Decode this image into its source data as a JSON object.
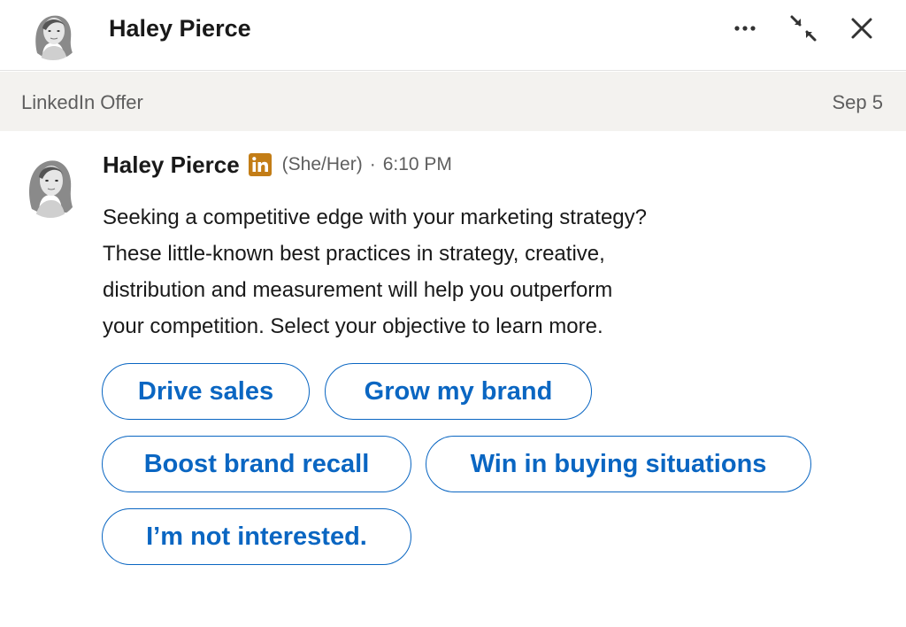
{
  "header": {
    "name": "Haley Pierce",
    "more_icon": "more-horizontal-icon",
    "minimize_icon": "minimize-arrows-icon",
    "close_icon": "close-icon"
  },
  "conversation": {
    "subject": "LinkedIn Offer",
    "date": "Sep 5"
  },
  "message": {
    "sender": "Haley Pierce",
    "badge_icon": "linkedin-logo-icon",
    "pronouns": "(She/Her)",
    "separator": "·",
    "time": "6:10 PM",
    "body_lines": [
      "Seeking a competitive edge with your marketing strategy?",
      "These little-known best practices in strategy, creative,",
      "distribution and measurement will help you outperform",
      "your competition. Select your objective to learn more."
    ]
  },
  "options": [
    "Drive sales",
    "Grow my brand",
    "Boost brand recall",
    "Win in buying situations",
    "I’m not interested."
  ],
  "colors": {
    "accent": "#0a66c2",
    "badge": "#c37d16",
    "subject_bar_bg": "#f3f2ef",
    "muted_text": "#5e5e5e"
  }
}
